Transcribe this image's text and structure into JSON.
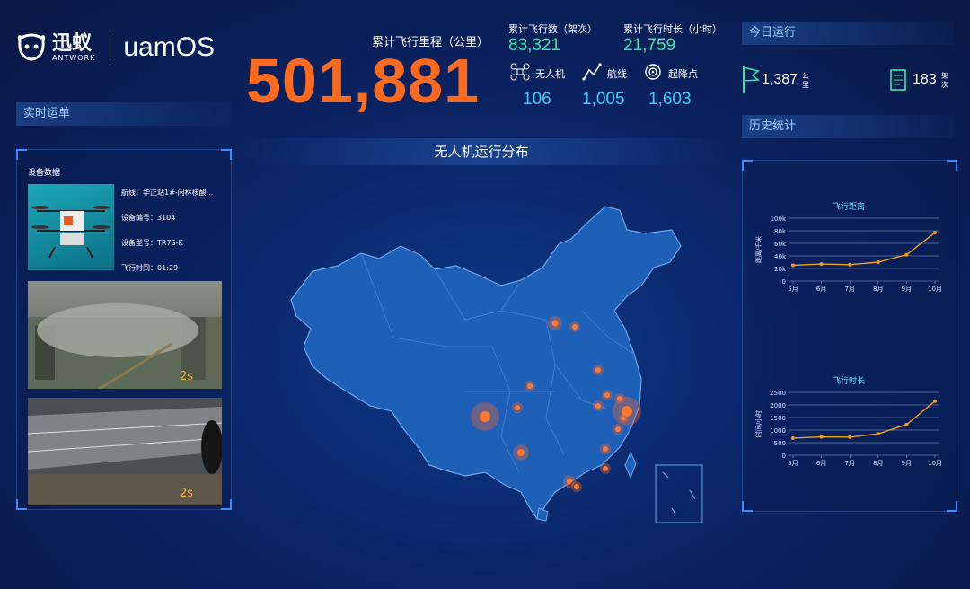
{
  "brand": {
    "cn": "迅蚁",
    "en": "ANTWORK",
    "product": "uamOS"
  },
  "mileage": {
    "label": "累计飞行里程（公里）",
    "value": "501,881"
  },
  "stats": {
    "sorties_label": "累计飞行数（架次）",
    "sorties_value": "83,321",
    "hours_label": "累计飞行时长（小时）",
    "hours_value": "21,759"
  },
  "mini": {
    "drones_label": "无人机",
    "drones_value": "106",
    "routes_label": "航线",
    "routes_value": "1,005",
    "pads_label": "起降点",
    "pads_value": "1,603"
  },
  "left": {
    "header": "实时运单",
    "device_title": "设备数据",
    "route": "航线：华正站1#-闲林核酸...",
    "device_no": "设备编号：3104",
    "device_model": "设备型号：TR7S-K",
    "flight_time": "飞行时间：01:29",
    "video1_badge": "2s",
    "video2_badge": "2s"
  },
  "map": {
    "title": "无人机运行分布"
  },
  "today": {
    "header": "今日运行",
    "distance_value": "1,387",
    "distance_unit": "公里",
    "sorties_value": "183",
    "sorties_unit": "架次"
  },
  "history": {
    "header": "历史统计"
  },
  "colors": {
    "accent_orange": "#ff6a1f",
    "accent_green": "#35e6a6",
    "accent_cyan": "#31d4ff",
    "line": "#f0a020"
  },
  "chart_data": [
    {
      "type": "line",
      "title": "飞行距离",
      "ylabel": "距离/千米",
      "categories": [
        "5月",
        "6月",
        "7月",
        "8月",
        "9月",
        "10月"
      ],
      "values": [
        25000,
        27000,
        26000,
        30000,
        42000,
        77000
      ],
      "yticks": [
        "0",
        "20k",
        "40k",
        "60k",
        "80k",
        "100k"
      ],
      "ylim": [
        0,
        100000
      ]
    },
    {
      "type": "line",
      "title": "飞行时长",
      "ylabel": "时间/小时",
      "categories": [
        "5月",
        "6月",
        "7月",
        "8月",
        "9月",
        "10月"
      ],
      "values": [
        680,
        730,
        720,
        850,
        1220,
        2150
      ],
      "yticks": [
        "0",
        "500",
        "1000",
        "1500",
        "2000",
        "2500"
      ],
      "ylim": [
        0,
        2500
      ]
    }
  ]
}
